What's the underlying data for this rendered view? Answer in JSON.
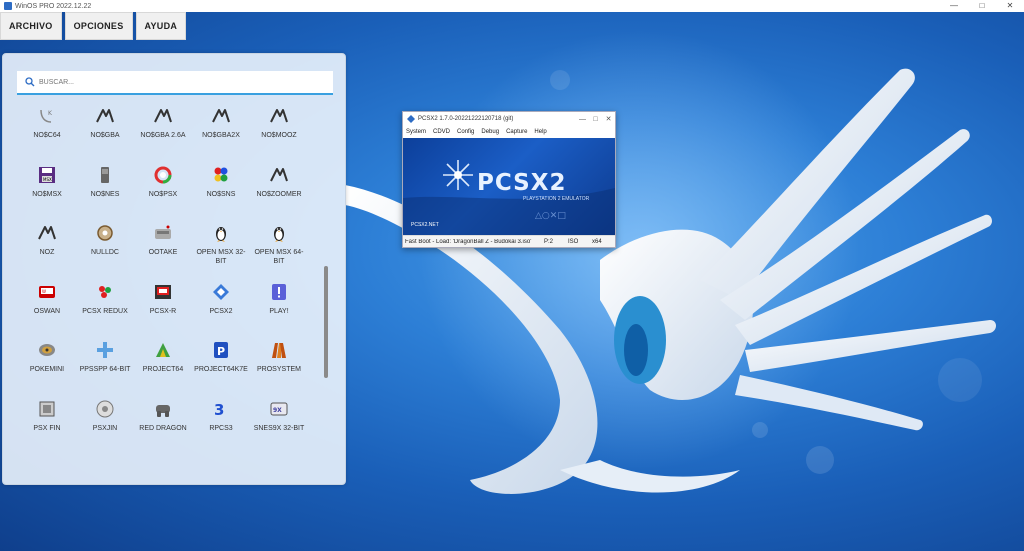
{
  "window": {
    "title": "WinOS PRO 2022.12.22",
    "minimize": "—",
    "maximize": "□",
    "close": "✕"
  },
  "menu": [
    "ARCHIVO",
    "OPCIONES",
    "AYUDA"
  ],
  "search": {
    "placeholder": "BUSCAR..."
  },
  "apps": [
    {
      "label": "NO$C64",
      "icon": "c64-icon"
    },
    {
      "label": "NO$GBA",
      "icon": "nogba-icon"
    },
    {
      "label": "NO$GBA 2.6A",
      "icon": "nogba-icon"
    },
    {
      "label": "NO$GBA2X",
      "icon": "nogba-icon"
    },
    {
      "label": "NO$MOOZ",
      "icon": "nogba-icon"
    },
    {
      "label": "NO$MSX",
      "icon": "msx-floppy-icon"
    },
    {
      "label": "NO$NES",
      "icon": "nes-cartridge-icon"
    },
    {
      "label": "NO$PSX",
      "icon": "psx-ring-icon"
    },
    {
      "label": "NO$SNS",
      "icon": "snes-buttons-icon"
    },
    {
      "label": "NO$ZOOMER",
      "icon": "nogba-icon"
    },
    {
      "label": "NOZ",
      "icon": "nogba-icon"
    },
    {
      "label": "NULLDC",
      "icon": "dreamcast-disc-icon"
    },
    {
      "label": "OOTAKE",
      "icon": "pce-console-icon"
    },
    {
      "label": "OPEN MSX 32-BIT",
      "icon": "penguin-icon"
    },
    {
      "label": "OPEN MSX 64-BIT",
      "icon": "penguin-icon"
    },
    {
      "label": "OSWAN",
      "icon": "wonderswan-icon"
    },
    {
      "label": "PCSX REDUX",
      "icon": "pcsx-redux-icon"
    },
    {
      "label": "PCSX-R",
      "icon": "pcsxr-icon"
    },
    {
      "label": "PCSX2",
      "icon": "pcsx2-icon"
    },
    {
      "label": "PLAY!",
      "icon": "play-exclamation-icon"
    },
    {
      "label": "POKEMINI",
      "icon": "pokemini-icon"
    },
    {
      "label": "PPSSPP 64-BIT",
      "icon": "ppsspp-icon"
    },
    {
      "label": "PROJECT64",
      "icon": "project64-icon"
    },
    {
      "label": "PROJECT64K7E",
      "icon": "project64k7e-icon"
    },
    {
      "label": "PROSYSTEM",
      "icon": "prosystem-icon"
    },
    {
      "label": "PSX FIN",
      "icon": "psxfin-icon"
    },
    {
      "label": "PSXJIN",
      "icon": "psxjin-icon"
    },
    {
      "label": "RED DRAGON",
      "icon": "red-dragon-icon"
    },
    {
      "label": "RPCS3",
      "icon": "rpcs3-icon"
    },
    {
      "label": "SNES9X 32-BIT",
      "icon": "snes9x-icon"
    }
  ],
  "pcsx2": {
    "title": "PCSX2  1.7.0-20221222120718 (git)",
    "menu": [
      "System",
      "CDVD",
      "Config",
      "Debug",
      "Capture",
      "Help"
    ],
    "logo": "PCSX2",
    "subtitle": "PLAYSTATION 2 EMULATOR",
    "site": "PCSX2.NET",
    "status": {
      "message": "Fast Boot - Load: 'DragonBall Z - Budokai 3.iso'",
      "port": "P:2",
      "media": "ISO",
      "arch": "x64"
    }
  },
  "colors": {
    "accent": "#39a0e0",
    "wallpaper": "#1a5fb8"
  }
}
